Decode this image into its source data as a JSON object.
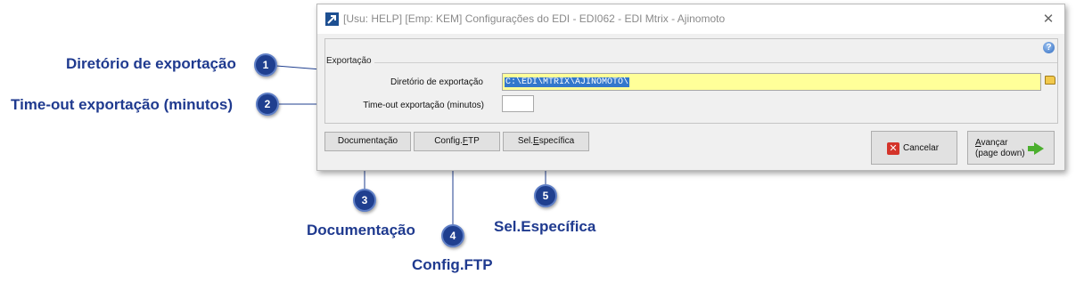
{
  "window": {
    "title": "[Usu: HELP] [Emp: KEM] Configurações do EDI - EDI062 - EDI Mtrix - Ajinomoto",
    "close_glyph": "✕",
    "help_glyph": "?"
  },
  "group": {
    "label": "Exportação",
    "directory_label": "Diretório  de exportação",
    "directory_value": "C:\\EDI\\MTRIX\\AJINOMOTO\\",
    "timeout_label": "Time-out exportação (minutos)",
    "timeout_value": ""
  },
  "buttons": {
    "documentacao": "Documentação",
    "config_ftp_prefix": "Config.",
    "config_ftp_ul": "F",
    "config_ftp_suffix": "TP",
    "sel_prefix": "Sel.",
    "sel_ul": "E",
    "sel_suffix": "specífica",
    "cancelar": "Cancelar",
    "avancar_ul": "A",
    "avancar_rest": "vançar",
    "avancar_sub": "(page down)"
  },
  "callouts": [
    {
      "number": "1",
      "label": "Diretório de exportação"
    },
    {
      "number": "2",
      "label": "Time-out exportação (minutos)"
    },
    {
      "number": "3",
      "label": "Documentação"
    },
    {
      "number": "4",
      "label": "Config.FTP"
    },
    {
      "number": "5",
      "label": "Sel.Específica"
    }
  ],
  "colors": {
    "callout_text": "#1f3a8f",
    "badge_fill": "#1f3f8f",
    "highlight_field": "#ffff99",
    "selection": "#3377cc"
  },
  "icons": {
    "app": "app-arrow-icon",
    "help": "help-icon",
    "folder": "folder-icon",
    "cancel": "red-x-icon",
    "next": "green-arrow-icon"
  }
}
